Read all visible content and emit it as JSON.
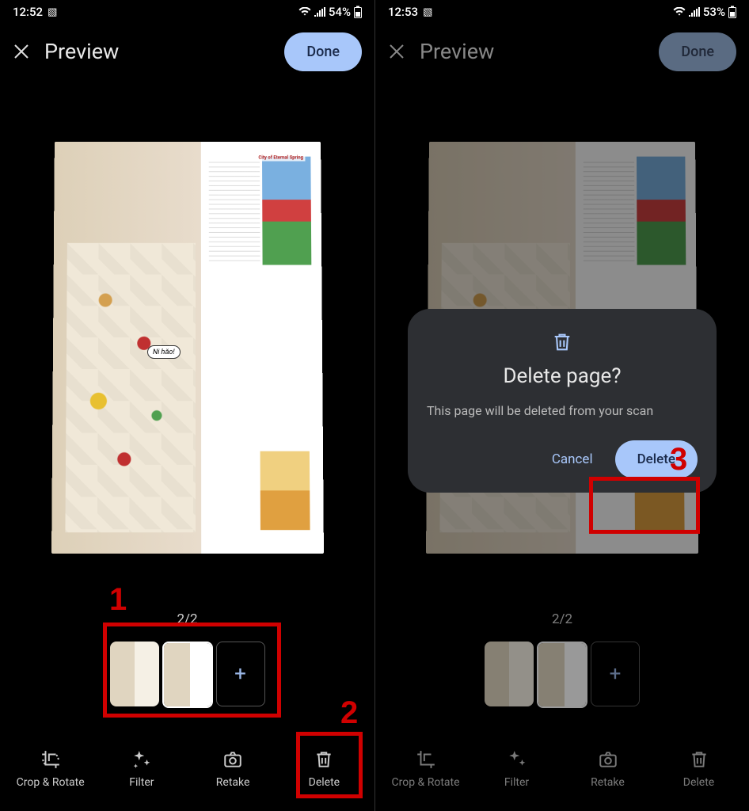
{
  "left": {
    "status": {
      "time": "12:52",
      "battery": "54%"
    },
    "header": {
      "title": "Preview",
      "done": "Done"
    },
    "counter": "2/2",
    "book": {
      "badge": "City of Eternal Spring",
      "bubble": "Ni hǎo!"
    },
    "bottom": [
      {
        "label": "Crop & Rotate"
      },
      {
        "label": "Filter"
      },
      {
        "label": "Retake"
      },
      {
        "label": "Delete"
      }
    ],
    "annotations": {
      "one": "1",
      "two": "2"
    }
  },
  "right": {
    "status": {
      "time": "12:53",
      "battery": "53%"
    },
    "header": {
      "title": "Preview",
      "done": "Done"
    },
    "counter": "2/2",
    "bottom": [
      {
        "label": "Crop & Rotate"
      },
      {
        "label": "Filter"
      },
      {
        "label": "Retake"
      },
      {
        "label": "Delete"
      }
    ],
    "dialog": {
      "title": "Delete page?",
      "body": "This page will be deleted from your scan",
      "cancel": "Cancel",
      "delete": "Delete"
    },
    "annotations": {
      "three": "3"
    }
  },
  "addGlyph": "+"
}
